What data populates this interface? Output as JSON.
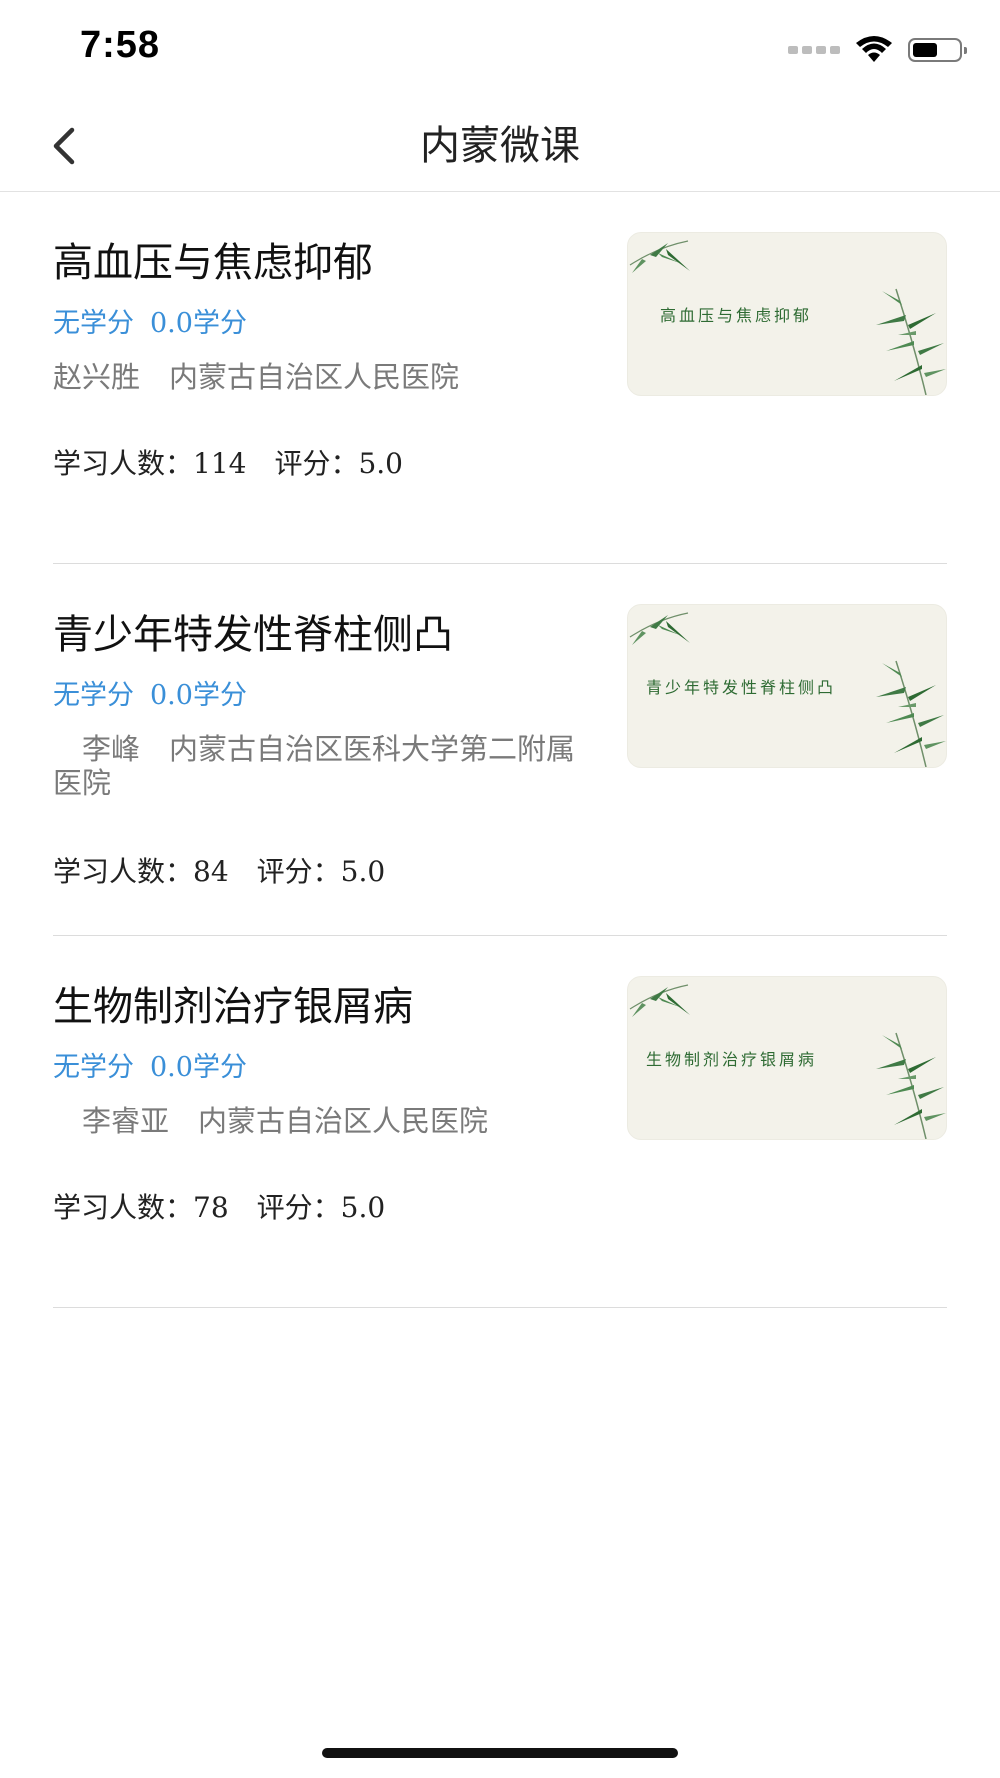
{
  "status_bar": {
    "time": "7:58"
  },
  "nav": {
    "title": "内蒙微课",
    "back_icon": "chevron-left-icon"
  },
  "courses": [
    {
      "title": "高血压与焦虑抑郁",
      "credit_type": "无学分",
      "credit_value": "0.0学分",
      "teacher": "赵兴胜　内蒙古自治区人民医院",
      "stats": "学习人数：114　评分：5.0",
      "thumb_title": "高血压与焦虑抑郁"
    },
    {
      "title": "青少年特发性脊柱侧凸",
      "credit_type": "无学分",
      "credit_value": "0.0学分",
      "teacher": "　李峰　内蒙古自治区医科大学第二附属医院",
      "stats": "学习人数：84　评分：5.0",
      "thumb_title": "青少年特发性脊柱侧凸"
    },
    {
      "title": "生物制剂治疗银屑病",
      "credit_type": "无学分",
      "credit_value": "0.0学分",
      "teacher": "　李睿亚　内蒙古自治区人民医院",
      "stats": "学习人数：78　评分：5.0",
      "thumb_title": "生物制剂治疗银屑病"
    }
  ],
  "colors": {
    "credit_blue": "#3a8fd8",
    "thumb_bg": "#f3f2ea",
    "bamboo_green": "#2e6b33"
  }
}
